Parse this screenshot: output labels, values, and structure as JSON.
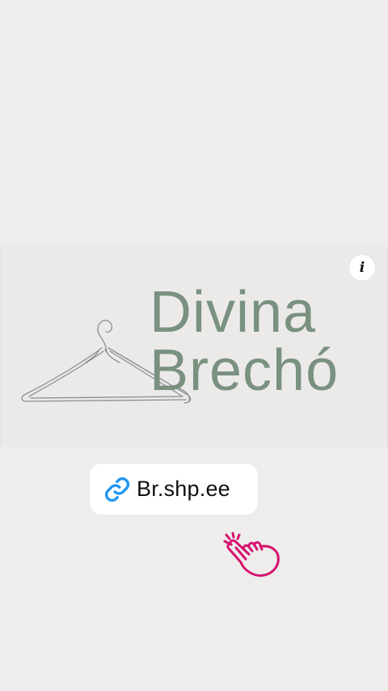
{
  "story": {
    "brand": {
      "line1": "Divina",
      "line2": "Brechó"
    },
    "info_button": {
      "icon": "info-icon",
      "label": "i"
    },
    "link_sticker": {
      "icon": "link-icon",
      "text": "Br.shp.ee"
    },
    "tap_hand": {
      "icon": "pointing-hand-icon"
    }
  },
  "colors": {
    "background": "#eeedec",
    "brand_text": "#7a9180",
    "link_icon": "#2196f3",
    "hand": "#d6136e"
  }
}
